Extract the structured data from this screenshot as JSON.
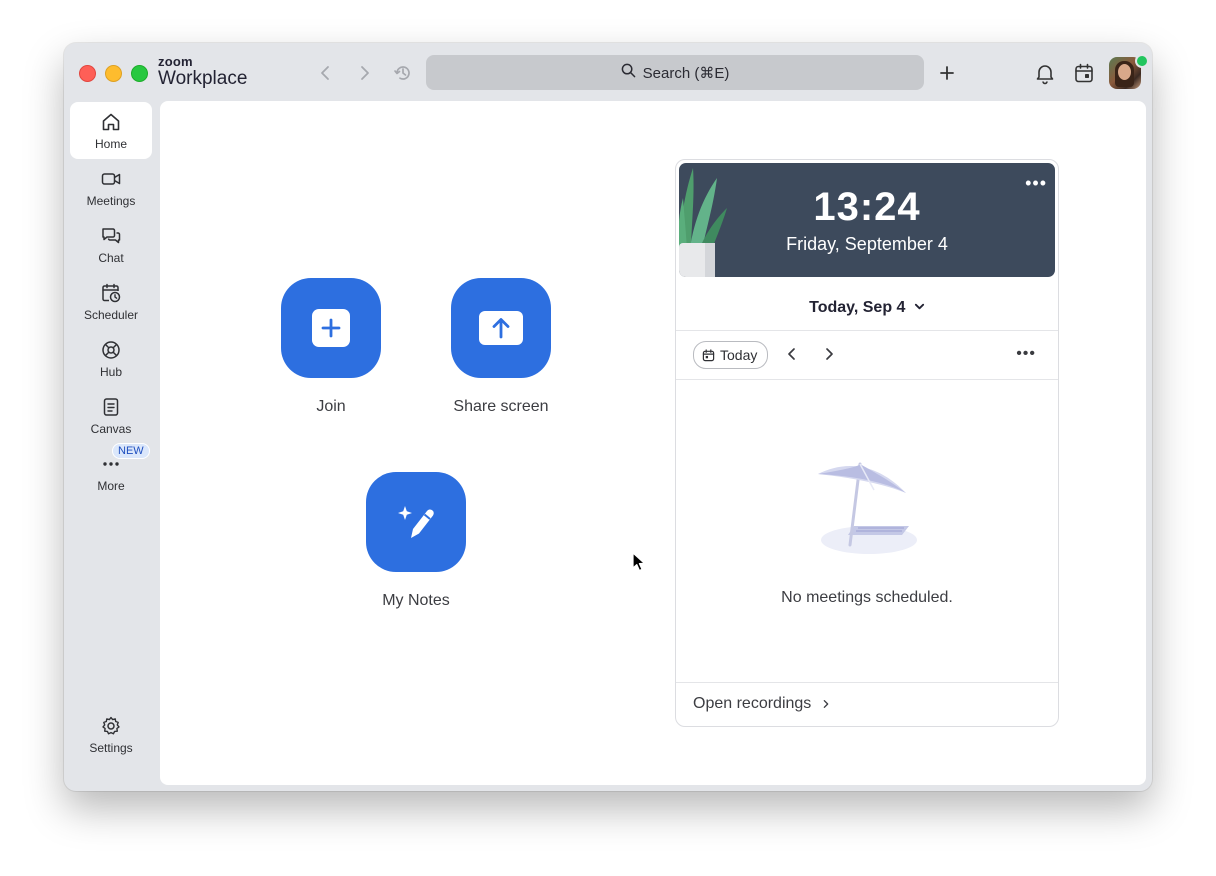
{
  "app": {
    "logo_top": "zoom",
    "logo_bottom": "Workplace"
  },
  "toolbar": {
    "search_placeholder": "Search (⌘E)",
    "icons": [
      "back-arrow-icon",
      "forward-arrow-icon",
      "history-icon",
      "search-icon",
      "plus-icon",
      "bell-icon",
      "calendar-icon"
    ]
  },
  "sidebar": {
    "items": [
      {
        "label": "Home",
        "icon": "home-icon",
        "active": true
      },
      {
        "label": "Meetings",
        "icon": "video-camera-icon"
      },
      {
        "label": "Chat",
        "icon": "chat-bubbles-icon"
      },
      {
        "label": "Scheduler",
        "icon": "calendar-clock-icon"
      },
      {
        "label": "Hub",
        "icon": "hub-icon"
      },
      {
        "label": "Canvas",
        "icon": "document-icon"
      },
      {
        "label": "More",
        "icon": "more-dots-icon",
        "badge": "NEW"
      }
    ],
    "settings_label": "Settings"
  },
  "actions": {
    "join_label": "Join",
    "share_label": "Share screen",
    "notes_label": "My Notes"
  },
  "calendar": {
    "time": "13:24",
    "date": "Friday, September 4",
    "day_header": "Today, Sep 4",
    "today_label": "Today",
    "empty_message": "No meetings scheduled.",
    "open_recordings_label": "Open recordings"
  },
  "colors": {
    "accent": "#2d6fe0",
    "clock_bg": "#3d4a5c",
    "window_bg": "#e3e5e9",
    "presence": "#22c55e"
  }
}
